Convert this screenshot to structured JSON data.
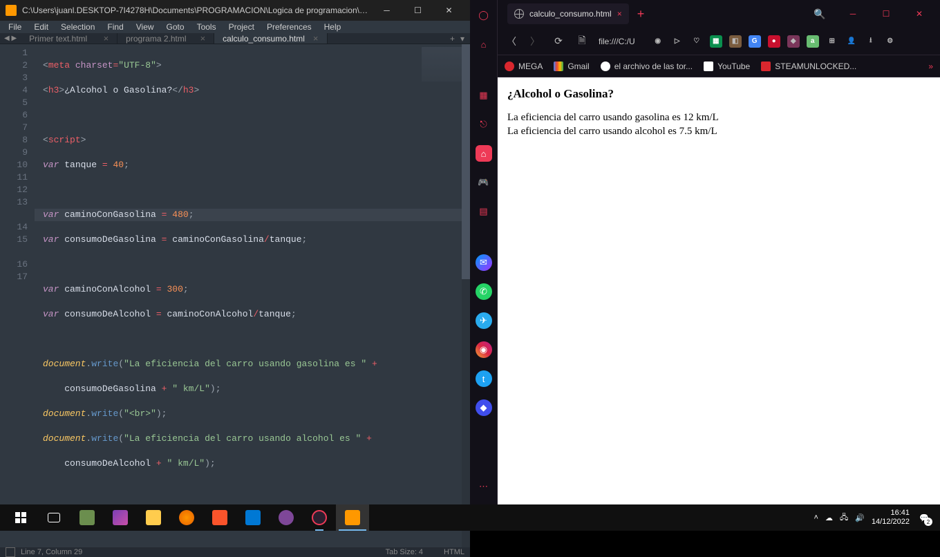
{
  "sublime": {
    "title": "C:\\Users\\juanl.DESKTOP-7I4278H\\Documents\\PROGRAMACION\\Logica de programacion\\calc...",
    "menu": [
      "File",
      "Edit",
      "Selection",
      "Find",
      "View",
      "Goto",
      "Tools",
      "Project",
      "Preferences",
      "Help"
    ],
    "tabs": [
      {
        "label": "Primer text.html",
        "active": false
      },
      {
        "label": "programa 2.html",
        "active": false
      },
      {
        "label": "calculo_consumo.html",
        "active": true
      }
    ],
    "status": {
      "position": "Line 7, Column 29",
      "tabsize": "Tab Size: 4",
      "syntax": "HTML"
    },
    "code_lines": 17,
    "active_line": 7
  },
  "opera": {
    "tab_title": "calculo_consumo.html",
    "address": "file:///C:/U",
    "bookmarks": [
      {
        "label": "MEGA",
        "color": "#d9272e"
      },
      {
        "label": "Gmail",
        "color": "#ea4335"
      },
      {
        "label": "el archivo de las tor...",
        "color": "#4285f4"
      },
      {
        "label": "YouTube",
        "color": "#ffffff"
      },
      {
        "label": "STEAMUNLOCKED...",
        "color": "#d9272e"
      }
    ]
  },
  "page": {
    "heading": "¿Alcohol o Gasolina?",
    "line1": "La eficiencia del carro usando gasolina es 12 km/L",
    "line2": "La eficiencia del carro usando alcohol es 7.5 km/L"
  },
  "taskbar": {
    "time": "16:41",
    "date": "14/12/2022",
    "notif_count": "2"
  }
}
